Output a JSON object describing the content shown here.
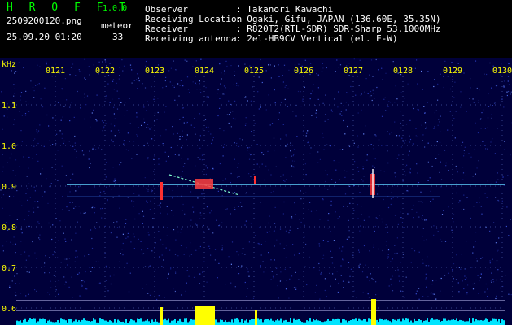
{
  "header": {
    "logo": "H R O F F T",
    "version": "1.0.0",
    "filename": "2509200120.png",
    "meteor_label": "meteor",
    "datetime": "25.09.20 01:20",
    "meteor_count": "33"
  },
  "station": {
    "observer_label": "Observer",
    "observer_value": ": Takanori Kawachi",
    "location_label": "Receiving Location",
    "location_value": ": Ogaki, Gifu, JAPAN (136.60E, 35.35N)",
    "receiver_label": "Receiver",
    "receiver_value": ": R820T2(RTL-SDR) SDR-Sharp 53.1000MHz",
    "antenna_label": "Receiving antenna",
    "antenna_value": ": 2el-HB9CV Vertical (el. E-W)"
  },
  "axis": {
    "y_unit": "kHz",
    "x_ticks": [
      "0121",
      "0122",
      "0123",
      "0124",
      "0125",
      "0126",
      "0127",
      "0128",
      "0129",
      "0130"
    ],
    "y_ticks": [
      "1.1",
      "1.0",
      "0.9",
      "0.8",
      "0.7",
      "0.6"
    ]
  },
  "colors": {
    "background": "#00003a",
    "tick_text": "#ffff00",
    "carrier": "#5fd3ff",
    "meteor": "#ff3030",
    "baseline": "#00e5ff",
    "burst": "#ffff00"
  }
}
